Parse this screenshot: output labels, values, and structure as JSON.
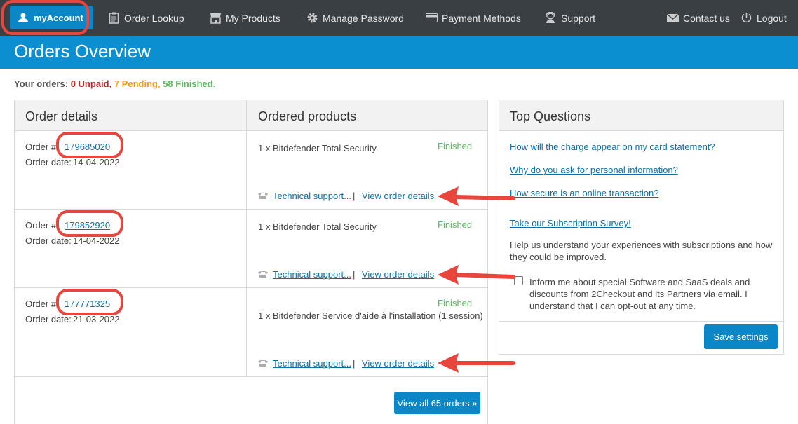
{
  "nav": {
    "items": [
      {
        "label": "myAccount",
        "icon": "user-icon"
      },
      {
        "label": "Order Lookup",
        "icon": "clipboard-icon"
      },
      {
        "label": "My Products",
        "icon": "store-icon"
      },
      {
        "label": "Manage Password",
        "icon": "gear-icon"
      },
      {
        "label": "Payment Methods",
        "icon": "credit-card-icon"
      },
      {
        "label": "Support",
        "icon": "support-agent-icon"
      },
      {
        "label": "Contact us",
        "icon": "envelope-icon"
      },
      {
        "label": "Logout",
        "icon": "power-icon"
      }
    ]
  },
  "page": {
    "title": "Orders Overview"
  },
  "summary": {
    "prefix": "Your orders:",
    "unpaid": "0 Unpaid,",
    "pending": "7 Pending,",
    "finished": "58 Finished."
  },
  "orders_table": {
    "col_order_details": "Order details",
    "col_ordered_products": "Ordered products",
    "order_no_label": "Order #:",
    "order_date_label": "Order date:",
    "tech_support": "Technical support...",
    "view_details": "View order details",
    "rows": [
      {
        "number": "179685020",
        "date": "14-04-2022",
        "product": "1 x Bitdefender Total Security",
        "status": "Finished"
      },
      {
        "number": "179852920",
        "date": "14-04-2022",
        "product": "1 x Bitdefender Total Security",
        "status": "Finished"
      },
      {
        "number": "177771325",
        "date": "21-03-2022",
        "product": "1 x Bitdefender Service d'aide à l'installation (1 session)",
        "status": "Finished"
      }
    ],
    "view_all": "View all 65 orders »"
  },
  "faq": {
    "title": "Top Questions",
    "q1": "How will the charge appear on my card statement?",
    "q2": "Why do you ask for personal information?",
    "q3": "How secure is an online transaction?",
    "survey": "Take our Subscription Survey!",
    "help": "Help us understand your experiences with subscriptions and how they could be improved.",
    "consent": "Inform me about special Software and SaaS deals and discounts from 2Checkout and its Partners via email. I understand that I can opt-out at any time.",
    "save": "Save settings"
  },
  "colors": {
    "accent": "#0b86c6",
    "annotation": "#e8453c",
    "finished": "#5cb85c",
    "pending": "#f39c12",
    "unpaid": "#c62828"
  }
}
